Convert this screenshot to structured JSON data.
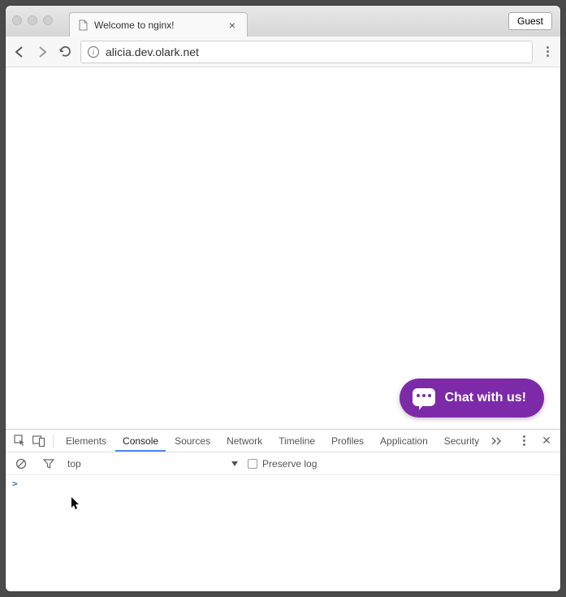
{
  "browser": {
    "tab_title": "Welcome to nginx!",
    "guest_label": "Guest",
    "url": "alicia.dev.olark.net"
  },
  "page": {
    "chat_widget_label": "Chat with us!"
  },
  "devtools": {
    "tabs": {
      "elements": "Elements",
      "console": "Console",
      "sources": "Sources",
      "network": "Network",
      "timeline": "Timeline",
      "profiles": "Profiles",
      "application": "Application",
      "security": "Security"
    },
    "context_selector": "top",
    "preserve_log_label": "Preserve log",
    "prompt_symbol": ">"
  }
}
